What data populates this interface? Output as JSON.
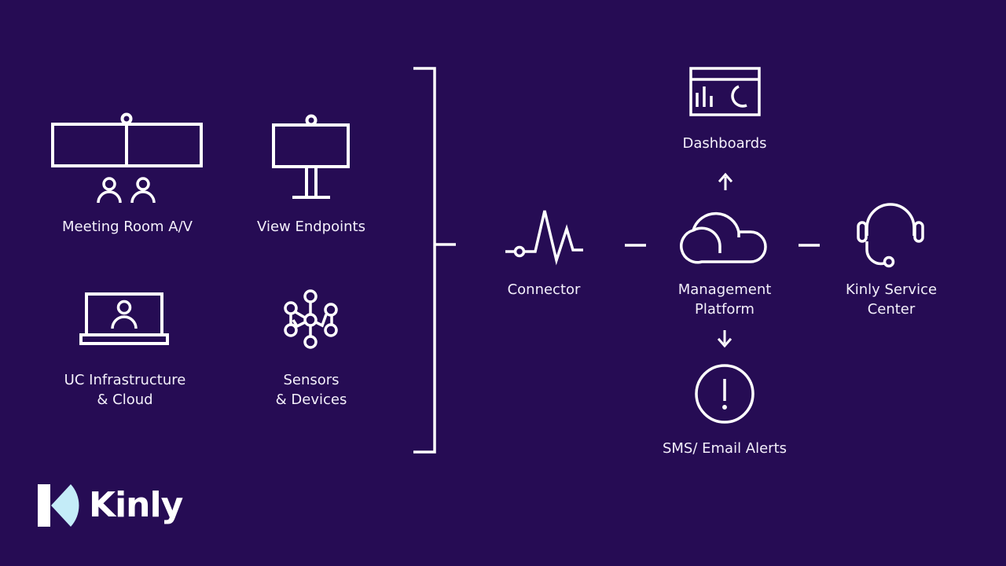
{
  "colors": {
    "background": "#260c54",
    "stroke": "#ffffff",
    "text": "#f4f0fb",
    "logo_accent": "#c4ecf8"
  },
  "sources": [
    {
      "id": "meeting-room",
      "icon": "video-wall-icon",
      "lines": [
        "Meeting Room A/V"
      ]
    },
    {
      "id": "view-endpoints",
      "icon": "display-endpoint-icon",
      "lines": [
        "View Endpoints"
      ]
    },
    {
      "id": "uc-infrastructure",
      "icon": "laptop-user-icon",
      "lines": [
        "UC Infrastructure",
        "& Cloud"
      ]
    },
    {
      "id": "sensors",
      "icon": "network-nodes-icon",
      "lines": [
        "Sensors",
        "& Devices"
      ]
    }
  ],
  "flow": [
    {
      "id": "connector",
      "icon": "pulse-connector-icon",
      "lines": [
        "Connector"
      ]
    },
    {
      "id": "management-platform",
      "icon": "cloud-icon",
      "lines": [
        "Management",
        "Platform"
      ]
    },
    {
      "id": "service-center",
      "icon": "headset-icon",
      "lines": [
        "Kinly Service",
        "Center"
      ]
    }
  ],
  "outputs": [
    {
      "id": "dashboards",
      "icon": "dashboard-icon",
      "direction": "up",
      "lines": [
        "Dashboards"
      ]
    },
    {
      "id": "alerts",
      "icon": "alert-icon",
      "direction": "down",
      "lines": [
        "SMS/ Email Alerts"
      ]
    }
  ],
  "brand": {
    "name": "Kinly",
    "logo_icon": "kinly-k-logo-icon"
  }
}
